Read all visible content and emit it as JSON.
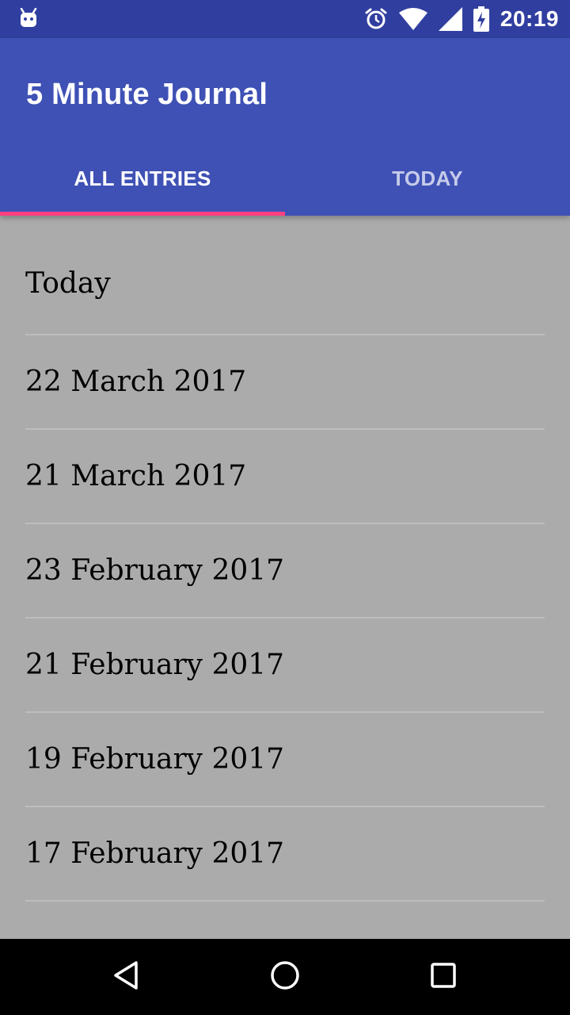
{
  "status_bar": {
    "time": "20:19",
    "icons": [
      "android-robot-icon",
      "alarm-icon",
      "wifi-icon",
      "cell-signal-icon",
      "battery-charging-icon"
    ]
  },
  "app_bar": {
    "title": "5 Minute Journal",
    "color": "#3f51b5",
    "status_color": "#303f9f",
    "accent": "#ff4081"
  },
  "tabs": [
    {
      "label": "ALL ENTRIES",
      "selected": true
    },
    {
      "label": "TODAY",
      "selected": false
    }
  ],
  "entries": [
    {
      "label": "Today"
    },
    {
      "label": "22 March 2017"
    },
    {
      "label": "21 March 2017"
    },
    {
      "label": "23 February 2017"
    },
    {
      "label": "21 February 2017"
    },
    {
      "label": "19 February 2017"
    },
    {
      "label": "17 February 2017"
    }
  ],
  "nav_bar": {
    "icons": [
      "back-icon",
      "home-icon",
      "recents-icon"
    ]
  }
}
